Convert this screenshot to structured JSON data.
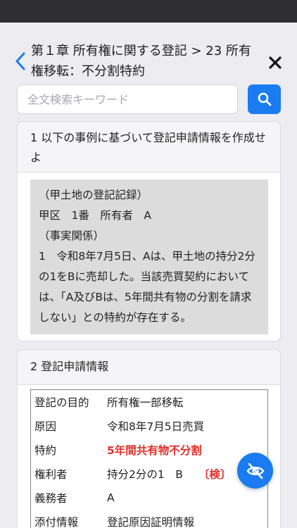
{
  "header": {
    "title": "第１章 所有権に関する登記 > 23 所有権移転：不分割特約"
  },
  "search": {
    "placeholder": "全文検索キーワード"
  },
  "section1": {
    "heading": "1 以下の事例に基づいて登記申請情報を作成せよ",
    "lines": [
      "（甲土地の登記記録）",
      "甲区　1番　所有者　A",
      "（事実関係）",
      "1　令和8年7月5日、Aは、甲土地の持分2分の1をBに売却した。当該売買契約においては、「A及びBは、5年間共有物の分割を請求しない」との特約が存在する。"
    ]
  },
  "section2": {
    "heading": "2 登記申請情報",
    "rows": [
      {
        "label": "登記の目的",
        "value": "所有権一部移転"
      },
      {
        "label": "原因",
        "value": "令和8年7月5日売買"
      },
      {
        "label": "特約",
        "value": "5年間共有物不分割"
      },
      {
        "label": "権利者",
        "value": "持分2分の1　B",
        "tag": "〔検〕"
      },
      {
        "label": "義務者",
        "value": "A"
      },
      {
        "label": "添付情報",
        "value": "登記原因証明情報"
      }
    ]
  },
  "colors": {
    "accent": "#1a7cf0",
    "highlight": "#e0302a"
  }
}
